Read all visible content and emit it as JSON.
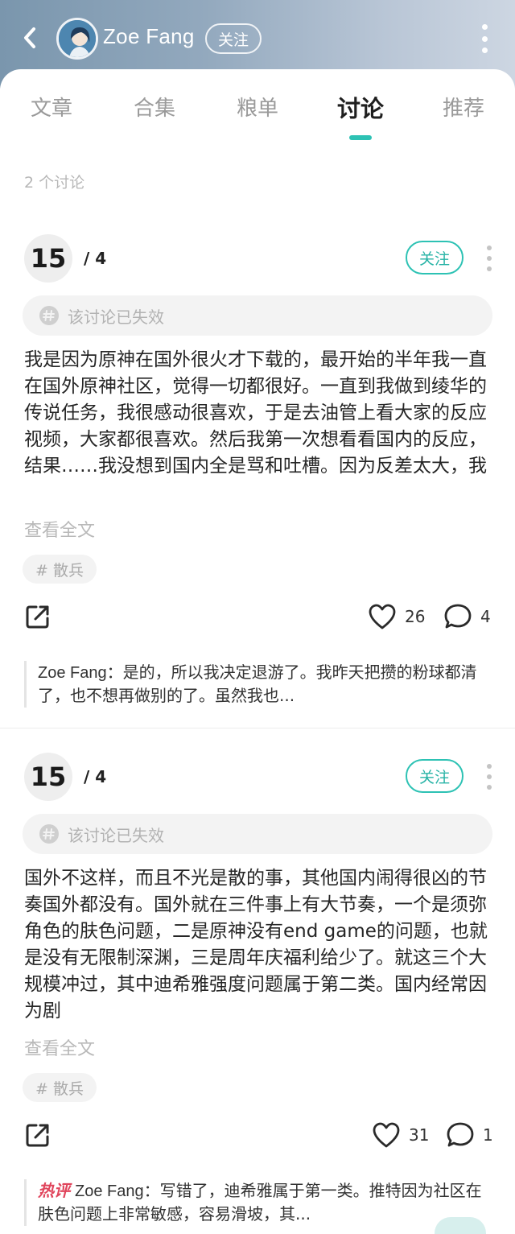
{
  "header": {
    "user_name": "Zoe Fang",
    "follow_label": "关注"
  },
  "tabs": [
    {
      "label": "文章"
    },
    {
      "label": "合集"
    },
    {
      "label": "粮单"
    },
    {
      "label": "讨论"
    },
    {
      "label": "推荐"
    }
  ],
  "active_tab": "讨论",
  "discussion_count": "2 个讨论",
  "posts": [
    {
      "score": "15",
      "score_total": "/ 4",
      "follow_label": "关注",
      "status": "该讨论已失效",
      "text": "我是因为原神在国外很火才下载的，最开始的半年我一直在国外原神社区，觉得一切都很好。一直到我做到绫华的传说任务，我很感动很喜欢，于是去油管上看大家的反应视频，大家都很喜欢。然后我第一次想看看国内的反应，结果……我没想到国内全是骂和吐槽。因为反差太大，我",
      "read_more": "查看全文",
      "tag": "# 散兵",
      "likes": "26",
      "comments": "4",
      "reply_badge": "",
      "reply_author": "Zoe Fang",
      "reply_text": "：是的，所以我决定退游了。我昨天把攒的粉球都清了，也不想再做别的了。虽然我也..."
    },
    {
      "score": "15",
      "score_total": "/ 4",
      "follow_label": "关注",
      "status": "该讨论已失效",
      "text": "国外不这样，而且不光是散的事，其他国内闹得很凶的节奏国外都没有。国外就在三件事上有大节奏，一个是须弥角色的肤色问题，二是原神没有end game的问题，也就是没有无限制深渊，三是周年庆福利给少了。就这三个大规模冲过，其中迪希雅强度问题属于第二类。国内经常因为剧",
      "read_more": "查看全文",
      "tag": "# 散兵",
      "likes": "31",
      "comments": "1",
      "reply_badge": "热评",
      "reply_author": "Zoe Fang",
      "reply_text": "：写错了，迪希雅属于第一类。推特因为社区在肤色问题上非常敏感，容易滑坡，其..."
    }
  ],
  "colors": {
    "accent": "#2dc2b4",
    "hot_badge": "#e0455c",
    "header_gradient_start": "#7a96ad",
    "header_gradient_end": "#cdd6e2"
  }
}
